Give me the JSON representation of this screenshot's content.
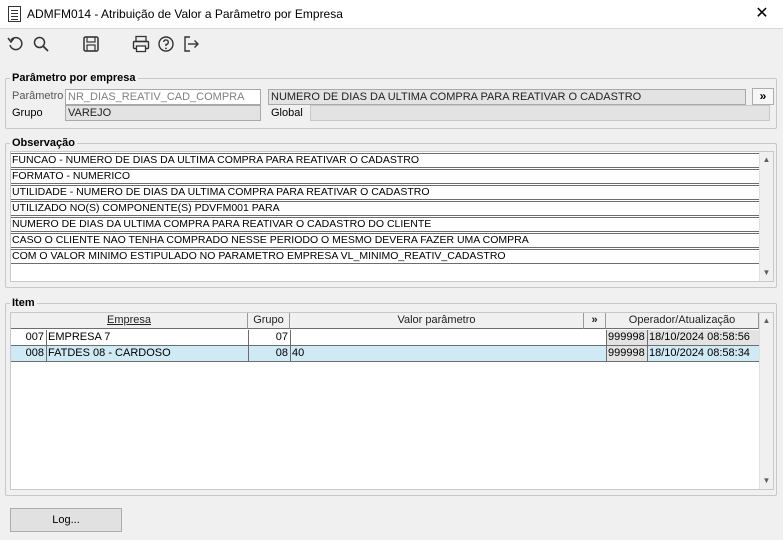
{
  "window": {
    "title": "ADMFM014 - Atribuição de Valor a Parâmetro por Empresa",
    "close_glyph": "✕"
  },
  "toolbar": {
    "buttons": [
      "undo-icon",
      "search-icon",
      "save-icon",
      "print-icon",
      "help-icon",
      "exit-icon"
    ]
  },
  "parametro_section": {
    "legend": "Parâmetro por empresa",
    "parametro_label": "Parâmetro",
    "parametro_value": "NR_DIAS_REATIV_CAD_COMPRA",
    "parametro_desc": "NUMERO DE DIAS DA ULTIMA COMPRA PARA REATIVAR O CADASTRO",
    "more_label": "»",
    "grupo_label": "Grupo",
    "grupo_value": "VAREJO",
    "global_label": "Global",
    "global_value": ""
  },
  "observacao": {
    "legend": "Observação",
    "lines": [
      "FUNCAO - NUMERO DE DIAS DA ULTIMA COMPRA PARA REATIVAR O CADASTRO",
      "FORMATO - NUMERICO",
      "UTILIDADE - NUMERO DE DIAS DA ULTIMA COMPRA PARA REATIVAR O CADASTRO",
      "UTILIZADO NO(S) COMPONENTE(S) PDVFM001 PARA",
      "NUMERO DE DIAS DA ULTIMA COMPRA PARA REATIVAR O CADASTRO DO CLIENTE",
      "CASO O CLIENTE NAO TENHA COMPRADO NESSE PERIODO O MESMO DEVERA FAZER UMA COMPRA",
      "COM O VALOR MINIMO ESTIPULADO NO PARAMETRO EMPRESA VL_MINIMO_REATIV_CADASTRO"
    ]
  },
  "item": {
    "legend": "Item",
    "columns": {
      "empresa": "Empresa",
      "grupo": "Grupo",
      "valor": "Valor parâmetro",
      "more": "»",
      "operador": "Operador/Atualização"
    },
    "rows": [
      {
        "codigo": "007",
        "empresa": "EMPRESA 7",
        "grupo": "07",
        "valor": "",
        "operador": "999998",
        "atualizacao": "18/10/2024 08:58:56"
      },
      {
        "codigo": "008",
        "empresa": "FATDES 08 - CARDOSO",
        "grupo": "08",
        "valor": "40",
        "operador": "999998",
        "atualizacao": "18/10/2024 08:58:34"
      }
    ]
  },
  "footer": {
    "log_label": "Log..."
  }
}
